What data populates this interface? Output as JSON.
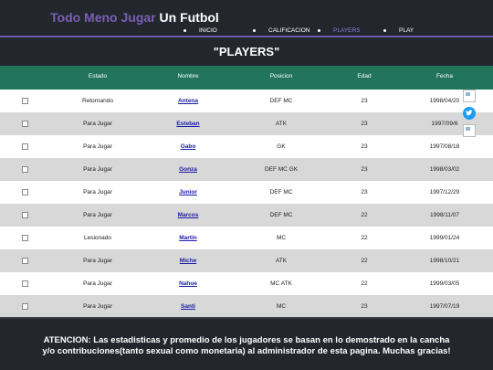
{
  "header": {
    "title_part1": "Todo Meno Jugar",
    "title_part2": "Un Futbol"
  },
  "nav": [
    {
      "label": "INICIO",
      "active": false
    },
    {
      "label": "CALIFICACION",
      "active": false
    },
    {
      "label": "PLAYERS",
      "active": true
    },
    {
      "label": "PLAY",
      "active": false
    }
  ],
  "page_title": "\"PLAYERS\"",
  "table": {
    "columns": [
      "Estado",
      "Nombre",
      "Posicion",
      "Edad",
      "Fecha"
    ],
    "rows": [
      {
        "estado": "Retornando",
        "nombre": "Antena",
        "posicion": "DEF MC",
        "edad": "23",
        "fecha": "1998/04/20"
      },
      {
        "estado": "Para Jugar",
        "nombre": "Esteban",
        "posicion": "ATK",
        "edad": "23",
        "fecha": "1997/09/6"
      },
      {
        "estado": "Para Jugar",
        "nombre": "Gabo",
        "posicion": "GK",
        "edad": "23",
        "fecha": "1997/08/18"
      },
      {
        "estado": "Para Jugar",
        "nombre": "Gonza",
        "posicion": "DEF MC GK",
        "edad": "23",
        "fecha": "1998/03/02"
      },
      {
        "estado": "Para Jugar",
        "nombre": "Junior",
        "posicion": "DEF MC",
        "edad": "23",
        "fecha": "1997/12/29"
      },
      {
        "estado": "Para Jugar",
        "nombre": "Marcos",
        "posicion": "DEF MC",
        "edad": "22",
        "fecha": "1998/11/07"
      },
      {
        "estado": "Lesionado",
        "nombre": "Martin",
        "posicion": "MC",
        "edad": "22",
        "fecha": "1999/01/24"
      },
      {
        "estado": "Para Jugar",
        "nombre": "Miche",
        "posicion": "ATK",
        "edad": "22",
        "fecha": "1998/10/21"
      },
      {
        "estado": "Para Jugar",
        "nombre": "Nahue",
        "posicion": "MC ATK",
        "edad": "22",
        "fecha": "1999/03/05"
      },
      {
        "estado": "Para Jugar",
        "nombre": "Santi",
        "posicion": "MC",
        "edad": "23",
        "fecha": "1997/07/19"
      }
    ]
  },
  "side_icons": [
    "broken-image-icon",
    "twitter-icon",
    "broken-image-icon"
  ],
  "footer": {
    "text": "ATENCION: Las estadisticas y promedio de los jugadores se basan en lo demostrado en la cancha y/o contribuciones(tanto sexual como monetaria) al administrador de esta pagina. Muchas gracias!"
  },
  "colors": {
    "background": "#23262d",
    "accent": "#7b5fb6",
    "table_header": "#22755a",
    "row_alt": "#d8d8d8",
    "link": "#1a1aa6"
  }
}
